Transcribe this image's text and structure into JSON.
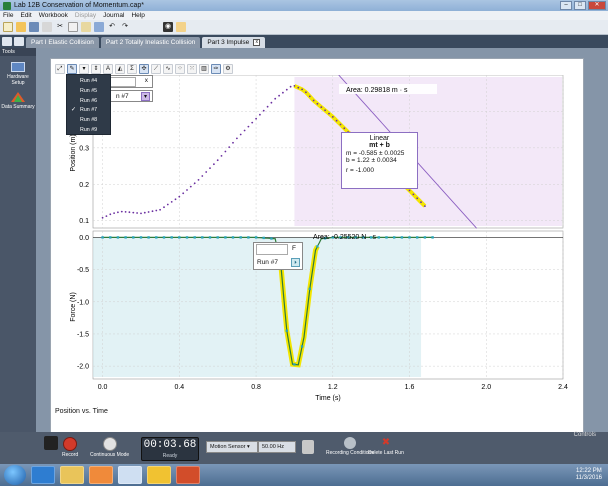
{
  "window": {
    "title": "Lab 12B Conservation of Momentum.cap*",
    "min": "–",
    "max": "□",
    "close": "✕"
  },
  "menu": [
    "File",
    "Edit",
    "Workbook",
    "Display",
    "Journal",
    "Help"
  ],
  "tabs": [
    {
      "label": "Part I Elastic Collision"
    },
    {
      "label": "Part 2 Totally Inelastic Collision"
    },
    {
      "label": "Part 3 Impulse",
      "active": true,
      "close": "x"
    }
  ],
  "tools_panel": {
    "header": "Tools",
    "items": [
      {
        "label": "Hardware Setup"
      },
      {
        "label": "Data Summary"
      }
    ]
  },
  "run_menu": {
    "items": [
      "Run #4",
      "Run #5",
      "Run #6",
      "Run #7",
      "Run #8",
      "Run #9"
    ],
    "checked": "Run #7"
  },
  "top_graph": {
    "run_label": "n #7",
    "close": "x",
    "ylabel": "Position (m)",
    "yticks": [
      "0.4",
      "0.3",
      "0.2",
      "0.1"
    ],
    "area_label": "Area: 0.29818 m · s",
    "fit": {
      "title": "Linear",
      "formula": "mt + b",
      "m": "m = -0.585 ± 0.0025",
      "b": "b = 1.22    ± 0.0034",
      "r": "r = -1.000"
    }
  },
  "bottom_graph": {
    "ylabel": "Force (N)",
    "yticks": [
      "0.0",
      "-0.5",
      "-1.0",
      "-1.5",
      "-2.0"
    ],
    "area_label": "Area: -0.25520 N · s",
    "legend_letter": "F",
    "run_label": "Run #7",
    "xlabel": "Time (s)",
    "xticks": [
      "0.0",
      "0.4",
      "0.8",
      "1.2",
      "1.6",
      "2.0",
      "2.4"
    ]
  },
  "page_caption": "Position vs. Time",
  "controls": {
    "header": "Controls",
    "record": "Record",
    "continuous": "Continuous Mode",
    "timer": "00:03.68",
    "status": "Ready",
    "sensor": "Motion Sensor",
    "rate": "50.00 Hz",
    "recording": "Recording Conditions",
    "delete": "Delete Last Run"
  },
  "taskbar": {
    "time": "12:22 PM",
    "date": "11/3/2016"
  },
  "colors": {
    "accent": "#1f5fa8",
    "data_point": "#6a2fa0",
    "highlight": "#f3e600",
    "force_fill": "#cfe9ef"
  },
  "chart_data": [
    {
      "type": "scatter",
      "title": "",
      "xlabel": "",
      "ylabel": "Position (m)",
      "xlim": [
        -0.05,
        2.4
      ],
      "ylim": [
        0.08,
        0.5
      ],
      "series": [
        {
          "x": [
            0.0,
            0.05,
            0.1,
            0.15,
            0.2,
            0.3,
            0.4,
            0.5,
            0.6,
            0.7,
            0.8,
            0.9,
            0.98,
            1.0,
            1.05,
            1.1,
            1.2,
            1.3,
            1.4,
            1.5,
            1.6,
            1.68
          ],
          "y": [
            0.108,
            0.12,
            0.125,
            0.123,
            0.12,
            0.13,
            0.166,
            0.212,
            0.266,
            0.326,
            0.38,
            0.435,
            0.468,
            0.47,
            0.458,
            0.43,
            0.385,
            0.333,
            0.27,
            0.233,
            0.183,
            0.14
          ]
        }
      ],
      "fit": {
        "type": "linear",
        "m": -0.585,
        "b": 1.22,
        "x_range": [
          1.0,
          1.72
        ]
      }
    },
    {
      "type": "line",
      "title": "",
      "xlabel": "Time (s)",
      "ylabel": "Force (N)",
      "xlim": [
        -0.05,
        2.4
      ],
      "ylim": [
        -2.2,
        0.1
      ],
      "series": [
        {
          "x": [
            0.0,
            0.2,
            0.4,
            0.6,
            0.8,
            0.9,
            0.93,
            0.96,
            0.99,
            1.02,
            1.05,
            1.08,
            1.11,
            1.14,
            1.2,
            1.4,
            1.6,
            1.72
          ],
          "y": [
            0.0,
            0.0,
            0.0,
            0.0,
            0.0,
            -0.02,
            -0.45,
            -1.45,
            -1.97,
            -1.98,
            -1.55,
            -0.8,
            -0.2,
            -0.02,
            0.0,
            0.0,
            0.0,
            0.0
          ]
        }
      ],
      "x_range_shaded": [
        -0.05,
        1.66
      ]
    }
  ]
}
